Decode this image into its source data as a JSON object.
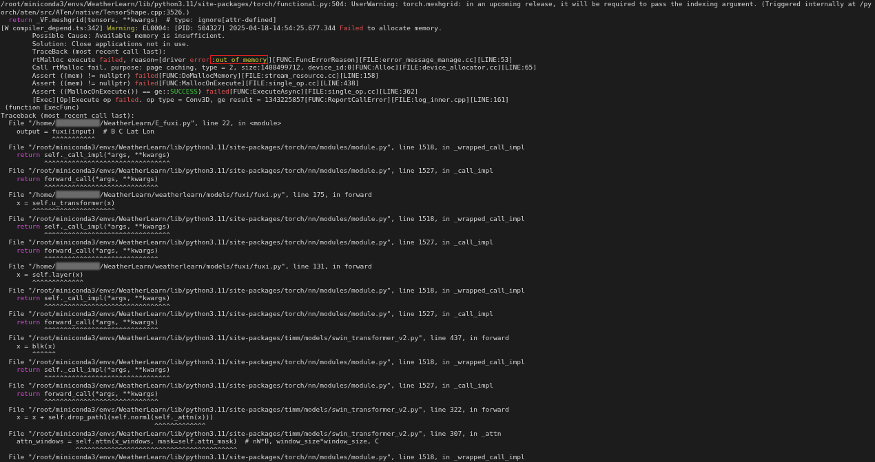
{
  "log": [
    [
      {
        "text": "/root/miniconda3/envs/WeatherLearn/lib/python3.11/site-packages/torch/functional.py:504: UserWarning: torch.meshgrid: in an upcoming release, it will be required to pass the indexing argument. (Triggered internally at /py"
      }
    ],
    [
      {
        "text": "orch/aten/src/ATen/native/TensorShape.cpp:3526.)"
      }
    ],
    [
      {
        "kind": "keyword",
        "text": "  return"
      },
      {
        "text": " _VF.meshgrid(tensors, **kwargs)  # type: ignore[attr-defined]"
      }
    ],
    [
      {
        "text": "[W compiler_depend.ts:342] "
      },
      {
        "kind": "warn",
        "text": "Warning"
      },
      {
        "text": ": EL0004: [PID: 504327] 2025-04-18-14:54:25.677.344 "
      },
      {
        "kind": "fail",
        "text": "Failed"
      },
      {
        "text": " to allocate memory."
      }
    ],
    [
      {
        "text": "        Possible Cause: Available memory is insufficient."
      }
    ],
    [
      {
        "text": "        Solution: Close applications not in use."
      }
    ],
    [
      {
        "text": "        TraceBack (most recent call last):"
      }
    ],
    [
      {
        "text": "        rtMalloc execute "
      },
      {
        "kind": "fail",
        "text": "failed"
      },
      {
        "text": ", reason=[driver "
      },
      {
        "kind": "fail",
        "text": "error"
      },
      {
        "kind": "boxed",
        "text": ":out of memory"
      },
      {
        "text": "][FUNC:FuncErrorReason][FILE:error_message_manage.cc][LINE:53]"
      }
    ],
    [
      {
        "text": "        Call rtMalloc fail, purpose: page caching, type = 2, size:1408499712, device_id:0[FUNC:Alloc][FILE:device_allocator.cc][LINE:65]"
      }
    ],
    [
      {
        "text": "        Assert ((mem) != nullptr) "
      },
      {
        "kind": "fail",
        "text": "failed"
      },
      {
        "text": "[FUNC:DoMallocMemory][FILE:stream_resource.cc][LINE:158]"
      }
    ],
    [
      {
        "text": "        Assert ((mem) != nullptr) "
      },
      {
        "kind": "fail",
        "text": "failed"
      },
      {
        "text": "[FUNC:MallocOnExecute][FILE:single_op.cc][LINE:438]"
      }
    ],
    [
      {
        "text": "        Assert ((MallocOnExecute()) == ge::"
      },
      {
        "kind": "success",
        "text": "SUCCESS"
      },
      {
        "text": ") "
      },
      {
        "kind": "fail",
        "text": "failed"
      },
      {
        "text": "[FUNC:ExecuteAsync][FILE:single_op.cc][LINE:362]"
      }
    ],
    [
      {
        "text": "        [Exec][Op]Execute op "
      },
      {
        "kind": "fail",
        "text": "failed"
      },
      {
        "text": ". op type = Conv3D, ge result = 1343225857[FUNC:ReportCallError][FILE:log_inner.cpp][LINE:161]"
      }
    ],
    [
      {
        "text": " (function ExecFunc)"
      }
    ]
  ],
  "traceback": {
    "header": "Traceback (most recent call last):",
    "frames": [
      {
        "location": [
          {
            "text": "  File \"/home/"
          },
          {
            "kind": "redacted"
          },
          {
            "text": "/WeatherLearn/E_fuxi.py\", line 22, in <module>"
          }
        ],
        "code": [
          {
            "text": "    output = fuxi(input)  # B C Lat Lon"
          }
        ],
        "carets": "             ^^^^^^^^^^^"
      },
      {
        "location": [
          {
            "text": "  File \"/root/miniconda3/envs/WeatherLearn/lib/python3.11/site-packages/torch/nn/modules/module.py\", line 1518, in _wrapped_call_impl"
          }
        ],
        "code": [
          {
            "kind": "keyword",
            "text": "    return"
          },
          {
            "text": " self._call_impl(*args, **kwargs)"
          }
        ],
        "carets": "           ^^^^^^^^^^^^^^^^^^^^^^^^^^^^^^^^"
      },
      {
        "location": [
          {
            "text": "  File \"/root/miniconda3/envs/WeatherLearn/lib/python3.11/site-packages/torch/nn/modules/module.py\", line 1527, in _call_impl"
          }
        ],
        "code": [
          {
            "kind": "keyword",
            "text": "    return"
          },
          {
            "text": " forward_call(*args, **kwargs)"
          }
        ],
        "carets": "           ^^^^^^^^^^^^^^^^^^^^^^^^^^^^^"
      },
      {
        "location": [
          {
            "text": "  File \"/home/"
          },
          {
            "kind": "redacted"
          },
          {
            "text": "/WeatherLearn/weatherlearn/models/fuxi/fuxi.py\", line 175, in forward"
          }
        ],
        "code": [
          {
            "text": "    x = self.u_transformer(x)"
          }
        ],
        "carets": "        ^^^^^^^^^^^^^^^^^^^^^"
      },
      {
        "location": [
          {
            "text": "  File \"/root/miniconda3/envs/WeatherLearn/lib/python3.11/site-packages/torch/nn/modules/module.py\", line 1518, in _wrapped_call_impl"
          }
        ],
        "code": [
          {
            "kind": "keyword",
            "text": "    return"
          },
          {
            "text": " self._call_impl(*args, **kwargs)"
          }
        ],
        "carets": "           ^^^^^^^^^^^^^^^^^^^^^^^^^^^^^^^^"
      },
      {
        "location": [
          {
            "text": "  File \"/root/miniconda3/envs/WeatherLearn/lib/python3.11/site-packages/torch/nn/modules/module.py\", line 1527, in _call_impl"
          }
        ],
        "code": [
          {
            "kind": "keyword",
            "text": "    return"
          },
          {
            "text": " forward_call(*args, **kwargs)"
          }
        ],
        "carets": "           ^^^^^^^^^^^^^^^^^^^^^^^^^^^^^"
      },
      {
        "location": [
          {
            "text": "  File \"/home/"
          },
          {
            "kind": "redacted"
          },
          {
            "text": "/WeatherLearn/weatherlearn/models/fuxi/fuxi.py\", line 131, in forward"
          }
        ],
        "code": [
          {
            "text": "    x = self.layer(x)"
          }
        ],
        "carets": "        ^^^^^^^^^^^^^"
      },
      {
        "location": [
          {
            "text": "  File \"/root/miniconda3/envs/WeatherLearn/lib/python3.11/site-packages/torch/nn/modules/module.py\", line 1518, in _wrapped_call_impl"
          }
        ],
        "code": [
          {
            "kind": "keyword",
            "text": "    return"
          },
          {
            "text": " self._call_impl(*args, **kwargs)"
          }
        ],
        "carets": "           ^^^^^^^^^^^^^^^^^^^^^^^^^^^^^^^^"
      },
      {
        "location": [
          {
            "text": "  File \"/root/miniconda3/envs/WeatherLearn/lib/python3.11/site-packages/torch/nn/modules/module.py\", line 1527, in _call_impl"
          }
        ],
        "code": [
          {
            "kind": "keyword",
            "text": "    return"
          },
          {
            "text": " forward_call(*args, **kwargs)"
          }
        ],
        "carets": "           ^^^^^^^^^^^^^^^^^^^^^^^^^^^^^"
      },
      {
        "location": [
          {
            "text": "  File \"/root/miniconda3/envs/WeatherLearn/lib/python3.11/site-packages/timm/models/swin_transformer_v2.py\", line 437, in forward"
          }
        ],
        "code": [
          {
            "text": "    x = blk(x)"
          }
        ],
        "carets": "        ^^^^^^"
      },
      {
        "location": [
          {
            "text": "  File \"/root/miniconda3/envs/WeatherLearn/lib/python3.11/site-packages/torch/nn/modules/module.py\", line 1518, in _wrapped_call_impl"
          }
        ],
        "code": [
          {
            "kind": "keyword",
            "text": "    return"
          },
          {
            "text": " self._call_impl(*args, **kwargs)"
          }
        ],
        "carets": "           ^^^^^^^^^^^^^^^^^^^^^^^^^^^^^^^^"
      },
      {
        "location": [
          {
            "text": "  File \"/root/miniconda3/envs/WeatherLearn/lib/python3.11/site-packages/torch/nn/modules/module.py\", line 1527, in _call_impl"
          }
        ],
        "code": [
          {
            "kind": "keyword",
            "text": "    return"
          },
          {
            "text": " forward_call(*args, **kwargs)"
          }
        ],
        "carets": "           ^^^^^^^^^^^^^^^^^^^^^^^^^^^^^"
      },
      {
        "location": [
          {
            "text": "  File \"/root/miniconda3/envs/WeatherLearn/lib/python3.11/site-packages/timm/models/swin_transformer_v2.py\", line 322, in forward"
          }
        ],
        "code": [
          {
            "text": "    x = x + self.drop_path1(self.norm1(self._attn(x)))"
          }
        ],
        "carets": "                                       ^^^^^^^^^^^^^"
      },
      {
        "location": [
          {
            "text": "  File \"/root/miniconda3/envs/WeatherLearn/lib/python3.11/site-packages/timm/models/swin_transformer_v2.py\", line 307, in _attn"
          }
        ],
        "code": [
          {
            "text": "    attn_windows = self.attn(x_windows, mask=self.attn_mask)  # nW*B, window_size*window_size, C"
          }
        ],
        "carets": "                   ^^^^^^^^^^^^^^^^^^^^^^^^^^^^^^^^^^^^^^^^^"
      },
      {
        "location": [
          {
            "text": "  File \"/root/miniconda3/envs/WeatherLearn/lib/python3.11/site-packages/torch/nn/modules/module.py\", line 1518, in _wrapped_call_impl"
          }
        ]
      }
    ]
  }
}
